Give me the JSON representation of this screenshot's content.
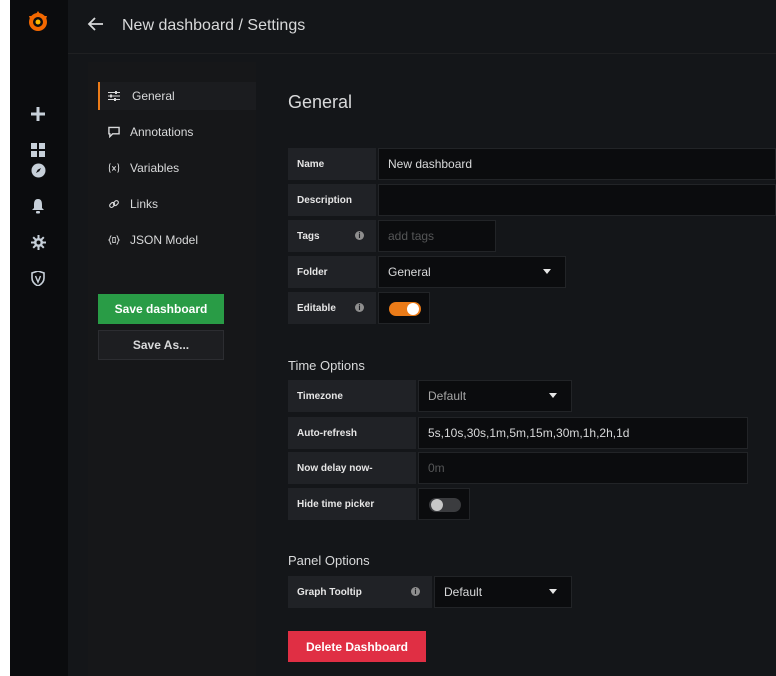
{
  "topbar": {
    "title": "New dashboard / Settings"
  },
  "nav": {
    "items": [
      {
        "label": "General",
        "icon": "sliders-icon",
        "active": true
      },
      {
        "label": "Annotations",
        "icon": "comment-icon",
        "active": false
      },
      {
        "label": "Variables",
        "icon": "variable-icon",
        "active": false
      },
      {
        "label": "Links",
        "icon": "link-icon",
        "active": false
      },
      {
        "label": "JSON Model",
        "icon": "json-braces-icon",
        "active": false
      }
    ],
    "save_label": "Save dashboard",
    "save_as_label": "Save As..."
  },
  "general": {
    "heading": "General",
    "name_label": "Name",
    "name_value": "New dashboard",
    "description_label": "Description",
    "description_value": "",
    "tags_label": "Tags",
    "tags_placeholder": "add tags",
    "folder_label": "Folder",
    "folder_value": "General",
    "editable_label": "Editable",
    "editable_on": true
  },
  "time_options": {
    "heading": "Time Options",
    "timezone_label": "Timezone",
    "timezone_value": "Default",
    "autorefresh_label": "Auto-refresh",
    "autorefresh_value": "5s,10s,30s,1m,5m,15m,30m,1h,2h,1d",
    "nowdelay_label": "Now delay now-",
    "nowdelay_placeholder": "0m",
    "hidetimepicker_label": "Hide time picker",
    "hidetimepicker_on": false
  },
  "panel_options": {
    "heading": "Panel Options",
    "graphtooltip_label": "Graph Tooltip",
    "graphtooltip_value": "Default"
  },
  "delete_label": "Delete Dashboard",
  "colors": {
    "accent_orange": "#eb7b18",
    "save_green": "#299c46",
    "delete_red": "#e02f44",
    "background": "#141619"
  }
}
